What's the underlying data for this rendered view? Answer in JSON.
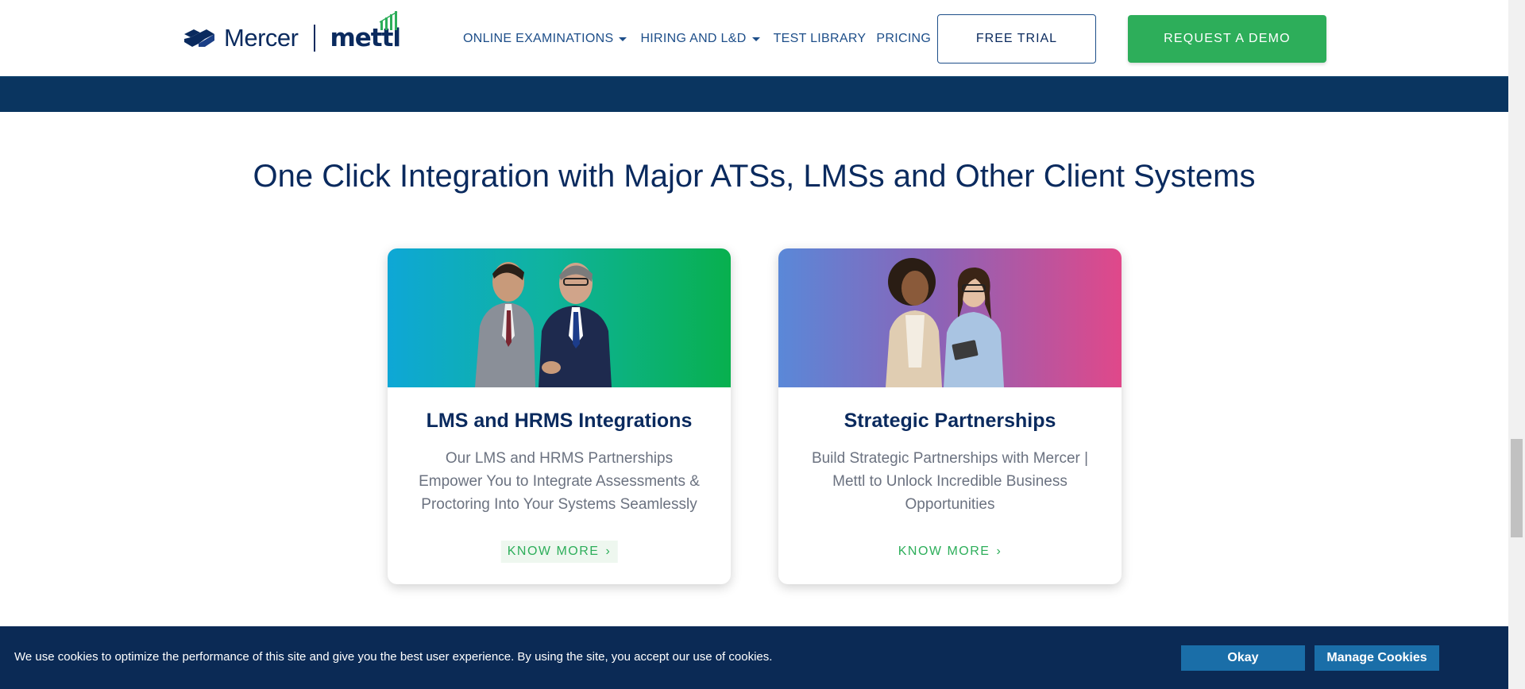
{
  "header": {
    "brand_primary": "Mercer",
    "brand_secondary": "mettl",
    "nav": [
      {
        "label": "ONLINE EXAMINATIONS",
        "has_dropdown": true
      },
      {
        "label": "HIRING AND L&D",
        "has_dropdown": true
      },
      {
        "label": "TEST LIBRARY",
        "has_dropdown": false
      },
      {
        "label": "PRICING",
        "has_dropdown": false
      }
    ],
    "free_trial_label": "FREE TRIAL",
    "request_demo_label": "REQUEST A DEMO"
  },
  "section": {
    "title": "One Click Integration with Major ATSs, LMSs and Other Client Systems"
  },
  "cards": [
    {
      "title": "LMS and HRMS Integrations",
      "description": "Our LMS and HRMS Partnerships Empower You to Integrate Assessments & Proctoring Into Your Systems Seamlessly",
      "cta": "KNOW MORE",
      "image_icon": "business-men-photo"
    },
    {
      "title": "Strategic Partnerships",
      "description": "Build Strategic Partnerships with Mercer | Mettl to Unlock Incredible Business Opportunities",
      "cta": "KNOW MORE",
      "image_icon": "business-women-photo"
    }
  ],
  "cookie": {
    "text": "We use cookies to optimize the performance of this site and give you the best user experience. By using the site, you accept our use of cookies.",
    "okay_label": "Okay",
    "manage_label": "Manage Cookies"
  },
  "colors": {
    "navy": "#0a2a5e",
    "band": "#0a3560",
    "green": "#2dae5a",
    "cookie_bg": "#0b2a55",
    "cookie_button": "#1a6ea8"
  }
}
